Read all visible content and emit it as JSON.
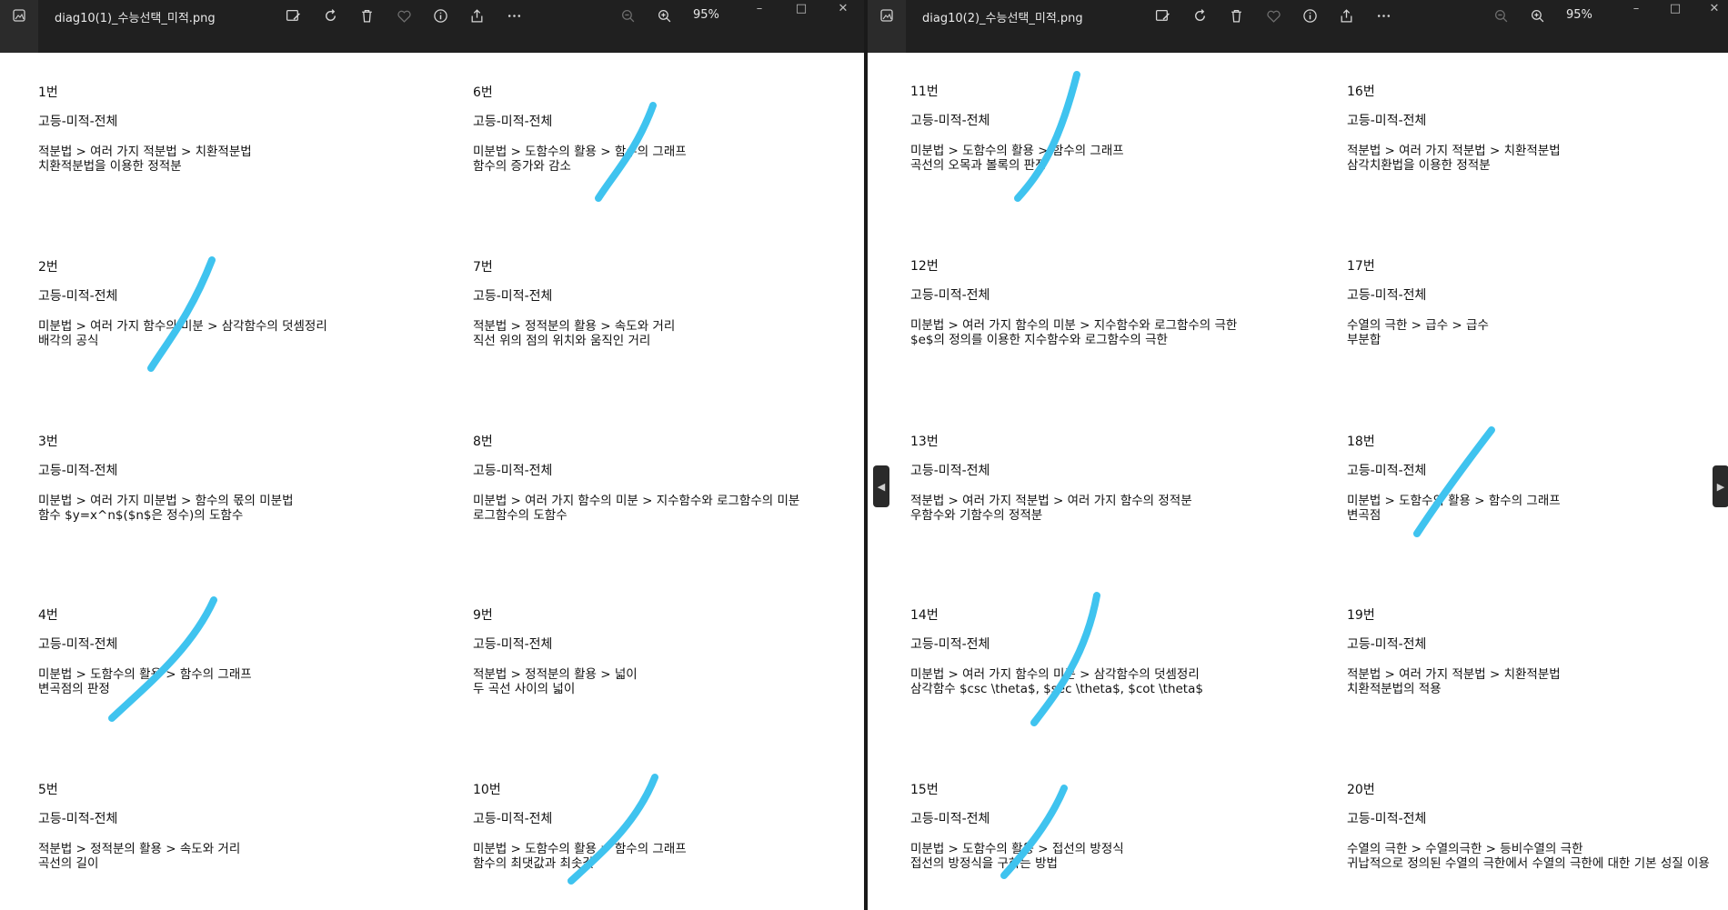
{
  "left": {
    "filename": "diag10(1)_수능선택_미적.png",
    "zoom": "95%",
    "entries": [
      {
        "num": "1번",
        "grade": "고등-미적-전체",
        "path": "적분법 > 여러 가지 적분법 > 치환적분법",
        "topic": "치환적분법을 이용한 정적분"
      },
      {
        "num": "2번",
        "grade": "고등-미적-전체",
        "path": "미분법 > 여러 가지 함수의 미분 > 삼각함수의 덧셈정리",
        "topic": "배각의 공식"
      },
      {
        "num": "3번",
        "grade": "고등-미적-전체",
        "path": "미분법 > 여러 가지 미분법 > 함수의 몫의 미분법",
        "topic": "함수 $y=x^n$($n$은 정수)의 도함수"
      },
      {
        "num": "4번",
        "grade": "고등-미적-전체",
        "path": "미분법 > 도함수의 활용 > 함수의 그래프",
        "topic": "변곡점의 판정"
      },
      {
        "num": "5번",
        "grade": "고등-미적-전체",
        "path": "적분법 > 정적분의 활용 > 속도와 거리",
        "topic": "곡선의 길이"
      },
      {
        "num": "6번",
        "grade": "고등-미적-전체",
        "path": "미분법 > 도함수의 활용 > 함수의 그래프",
        "topic": "함수의 증가와 감소"
      },
      {
        "num": "7번",
        "grade": "고등-미적-전체",
        "path": "적분법 > 정적분의 활용 > 속도와 거리",
        "topic": "직선 위의 점의 위치와 움직인 거리"
      },
      {
        "num": "8번",
        "grade": "고등-미적-전체",
        "path": "미분법 > 여러 가지 함수의 미분 > 지수함수와 로그함수의 미분",
        "topic": "로그함수의 도함수"
      },
      {
        "num": "9번",
        "grade": "고등-미적-전체",
        "path": "적분법 > 정적분의 활용 > 넓이",
        "topic": "두 곡선 사이의 넓이"
      },
      {
        "num": "10번",
        "grade": "고등-미적-전체",
        "path": "미분법 > 도함수의 활용 > 함수의 그래프",
        "topic": "함수의 최댓값과 최솟값"
      }
    ]
  },
  "right": {
    "filename": "diag10(2)_수능선택_미적.png",
    "zoom": "95%",
    "entries": [
      {
        "num": "11번",
        "grade": "고등-미적-전체",
        "path": "미분법 > 도함수의 활용 > 함수의 그래프",
        "topic": "곡선의 오목과 볼록의 판정"
      },
      {
        "num": "12번",
        "grade": "고등-미적-전체",
        "path": "미분법 > 여러 가지 함수의 미분 > 지수함수와 로그함수의 극한",
        "topic": "$e$의 정의를 이용한 지수함수와 로그함수의 극한"
      },
      {
        "num": "13번",
        "grade": "고등-미적-전체",
        "path": "적분법 > 여러 가지 적분법 > 여러 가지 함수의 정적분",
        "topic": "우함수와 기함수의 정적분"
      },
      {
        "num": "14번",
        "grade": "고등-미적-전체",
        "path": "미분법 > 여러 가지 함수의 미분 > 삼각함수의 덧셈정리",
        "topic": "삼각함수 $csc \\theta$, $sec \\theta$, $cot \\theta$"
      },
      {
        "num": "15번",
        "grade": "고등-미적-전체",
        "path": "미분법 > 도함수의 활용 > 접선의 방정식",
        "topic": "접선의 방정식을 구하는 방법"
      },
      {
        "num": "16번",
        "grade": "고등-미적-전체",
        "path": "적분법 > 여러 가지 적분법 > 치환적분법",
        "topic": "삼각치환법을 이용한 정적분"
      },
      {
        "num": "17번",
        "grade": "고등-미적-전체",
        "path": "수열의 극한 > 급수 > 급수",
        "topic": "부분합"
      },
      {
        "num": "18번",
        "grade": "고등-미적-전체",
        "path": "미분법 > 도함수의 활용 > 함수의 그래프",
        "topic": "변곡점"
      },
      {
        "num": "19번",
        "grade": "고등-미적-전체",
        "path": "적분법 > 여러 가지 적분법 > 치환적분법",
        "topic": "치환적분법의 적용"
      },
      {
        "num": "20번",
        "grade": "고등-미적-전체",
        "path": "수열의 극한 > 수열의극한 > 등비수열의 극한",
        "topic": "귀납적으로 정의된 수열의 극한에서 수열의 극한에 대한 기본 성질 이용"
      }
    ]
  },
  "colors": {
    "titlebar": "#202020",
    "annotation_stroke": "#3fc3ef",
    "page": "#ffffff"
  },
  "icons": [
    "photos-app-icon",
    "edit-image-icon",
    "rotate-icon",
    "delete-icon",
    "favorite-heart-icon",
    "info-icon",
    "share-icon",
    "more-dots-icon",
    "zoom-out-icon",
    "zoom-in-icon",
    "minimize-icon",
    "maximize-icon",
    "close-icon",
    "prev-arrow-icon",
    "next-arrow-icon"
  ]
}
